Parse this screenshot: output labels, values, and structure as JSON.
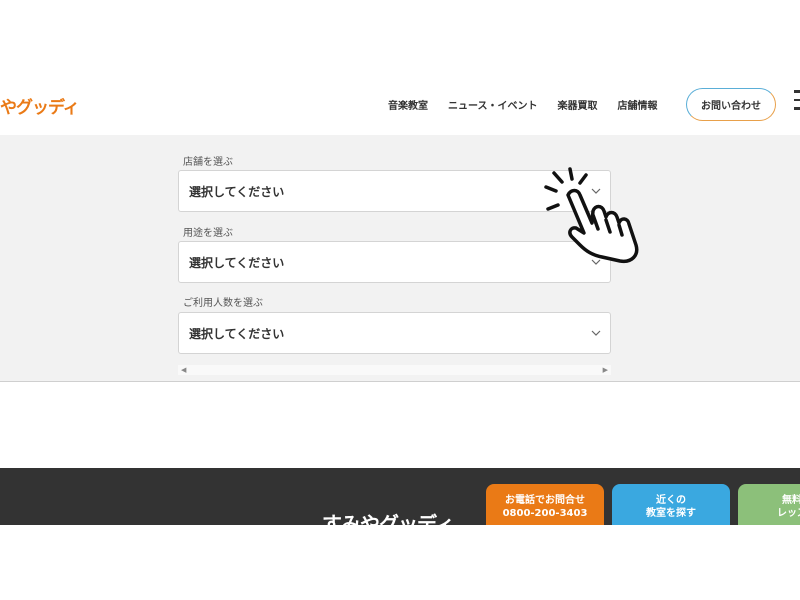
{
  "header": {
    "logo_text": "やグッディ",
    "nav": [
      "音楽教室",
      "ニュース・イベント",
      "楽器買取",
      "店舗情報"
    ],
    "contact_label": "お問い合わせ"
  },
  "form": {
    "fields": [
      {
        "label": "店舗を選ぶ",
        "value": "選択してください"
      },
      {
        "label": "用途を選ぶ",
        "value": "選択してください"
      },
      {
        "label": "ご利用人数を選ぶ",
        "value": "選択してください"
      }
    ]
  },
  "footer": {
    "logo_text": "すみやグッディ",
    "phone_line1": "お電話でお問合せ",
    "phone_line2": "0800-200-3403",
    "near_line1": "近くの",
    "near_line2": "教室を探す",
    "free_line1": "無料体",
    "free_line2": "レッスン"
  },
  "colors": {
    "brand_orange": "#ea7a16",
    "accent_blue": "#3aa8e0",
    "accent_green": "#8cc07a",
    "footer_bg": "#333333"
  }
}
